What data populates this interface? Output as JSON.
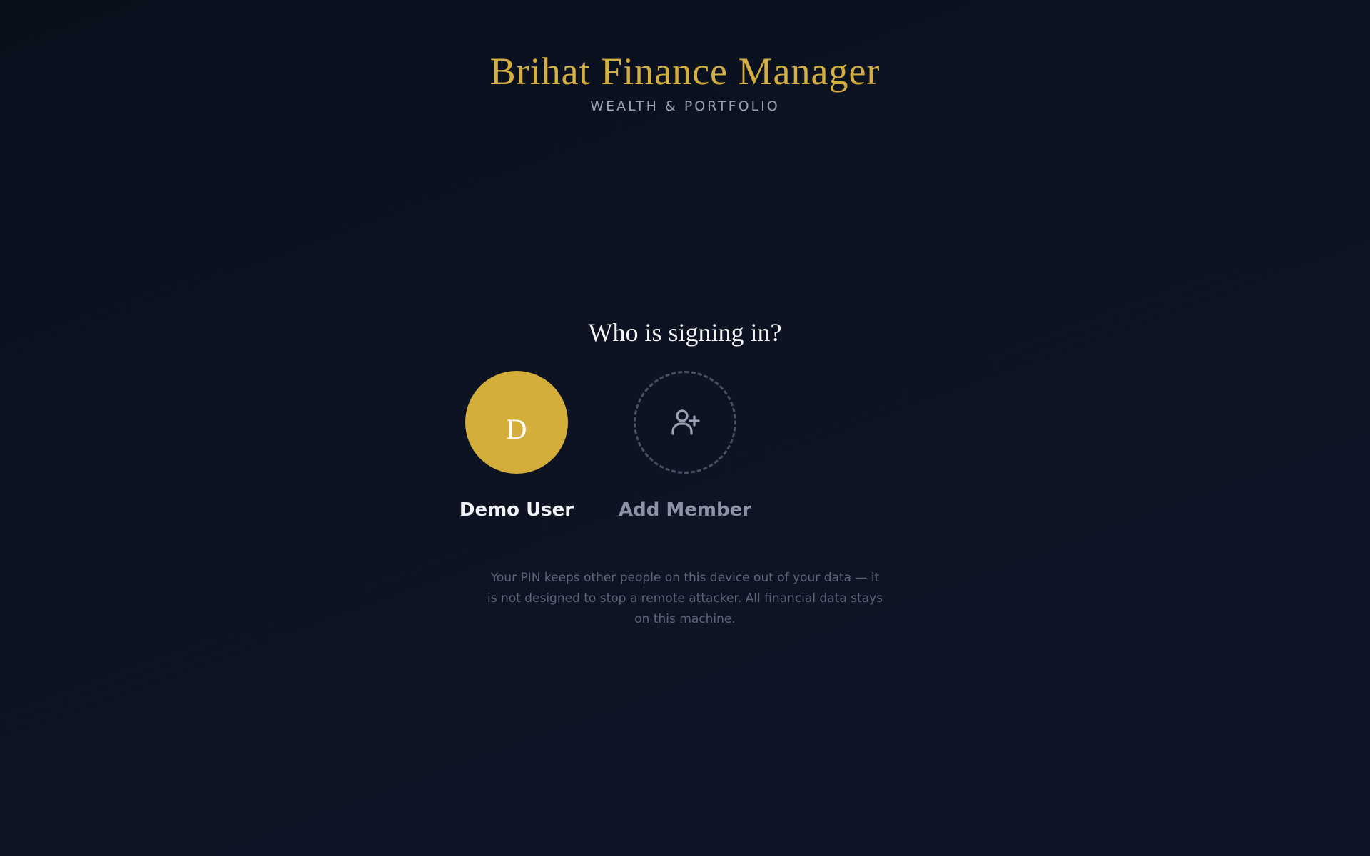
{
  "brand": {
    "title": "Brihat Finance Manager",
    "subtitle": "WEALTH & PORTFOLIO",
    "accent_color": "#d4ae3e"
  },
  "signin": {
    "heading": "Who is signing in?",
    "profiles": [
      {
        "initial": "D",
        "name": "Demo User",
        "avatar_color": "#d4ae3a"
      }
    ],
    "add_member": {
      "label": "Add Member",
      "icon": "user-plus-icon"
    }
  },
  "footer_note": "Your PIN keeps other people on this device out of your data — it is not designed to stop a remote attacker. All financial data stays on this machine."
}
